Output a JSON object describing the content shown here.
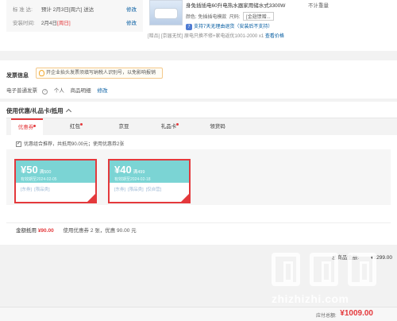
{
  "shipping": {
    "row1_label": "标 准 达:",
    "row1_value": "预计 2月3日[周六] 送达",
    "row1_modify": "修改",
    "row2_label": "安装时间:",
    "row2_value_prefix": "2月4日",
    "row2_value_highlight": "[周日]",
    "row2_modify": "修改"
  },
  "product": {
    "title": "身免插插电60升电热水器家用储水式3300W",
    "qty_note": "不计重量",
    "attr_color_label": "颜色:",
    "attr_color_value": "免插插电模款",
    "attr_size_label": "尺码:",
    "attr_size_value": "[金翅馈赠...",
    "service_text": "支持7天无理由退货（安装后不支持）",
    "gift_tag": "[赠品]",
    "gift_text": "[京届无忧] 原电只换不修+家电返优1001-2000 x1",
    "gift_link": "查看价格"
  },
  "invoice": {
    "title": "发票信息",
    "notice": "开企业抬头发票须填写纳税人识别号，以免影响报销",
    "type": "电子普通发票",
    "holder": "个人",
    "content": "商品明细",
    "modify": "修改"
  },
  "coupons": {
    "section_title": "使用优惠/礼品卡/抵用",
    "tabs": [
      {
        "label": "优惠券",
        "dot": true
      },
      {
        "label": "红包",
        "dot": true
      },
      {
        "label": "京豆",
        "dot": false
      },
      {
        "label": "礼品卡",
        "dot": true
      },
      {
        "label": "领货码",
        "dot": false
      }
    ],
    "combo_check": "✓",
    "combo_text": "优惠组合推荐，共抵用90.00元；使用优惠券2张",
    "items": [
      {
        "amount": "¥50",
        "condition": "满500",
        "valid": "有效期至2024-02-05",
        "tag1": "[东券]",
        "tag2": "[限品类]"
      },
      {
        "amount": "¥40",
        "condition": "满499",
        "valid": "有效期至2024-02-18",
        "tag1": "[东券]",
        "tag2": "[限品类]",
        "tag3": "[仅自营]"
      }
    ],
    "summary_label": "金额抵用",
    "summary_amount": "¥90.00",
    "summary_text": "使用优惠券 2 张，优惠 90.00 元"
  },
  "totals": {
    "goods_label": "总商品金额:",
    "goods_value": "¥1299.00",
    "pay_label": "应付总额:",
    "pay_value": "¥1009.00"
  },
  "watermark": {
    "text": "zhizhizhi.com"
  },
  "colors": {
    "accent": "#e4393c",
    "link": "#005aa0",
    "coupon_teal": "#7bd4d4"
  }
}
